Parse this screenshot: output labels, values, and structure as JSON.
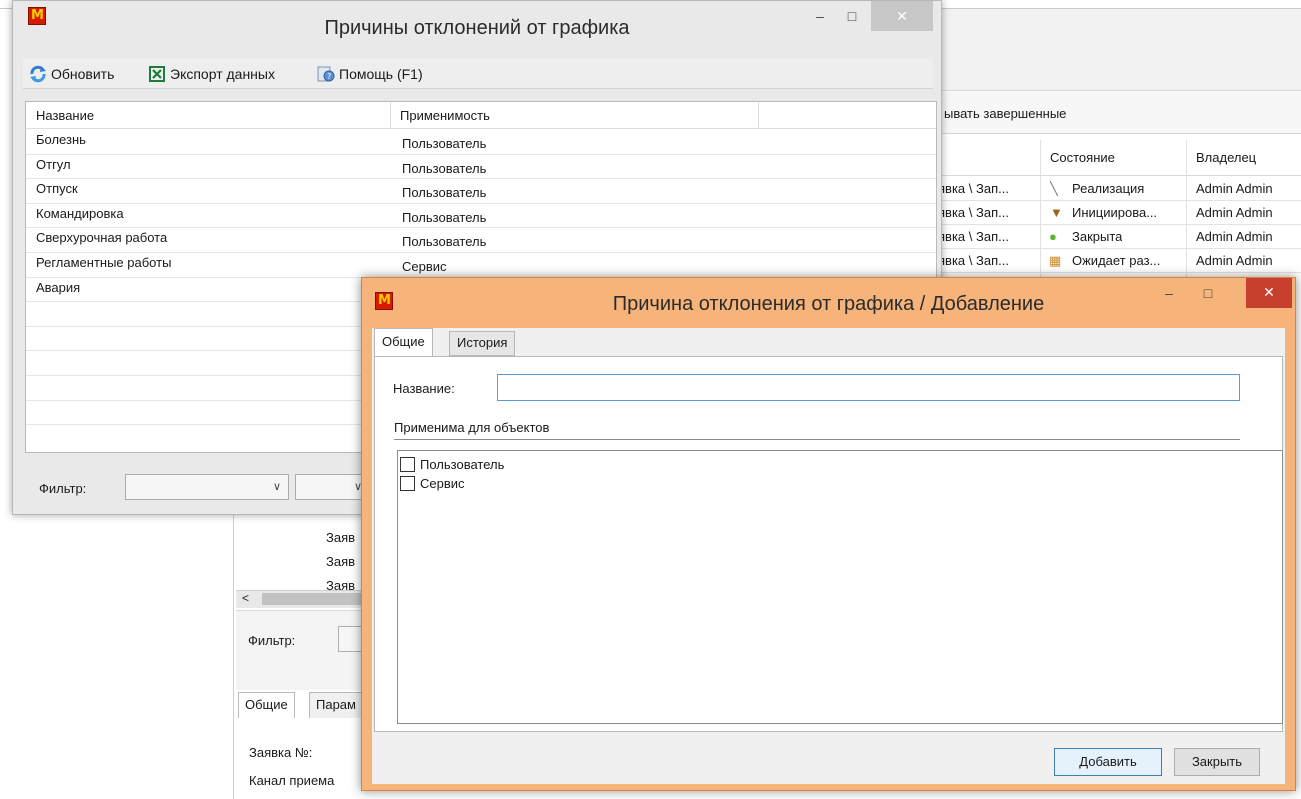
{
  "background_app": {
    "checkbar_text": "ывать завершенные",
    "grid_headers": {
      "state": "Состояние",
      "owner": "Владелец"
    },
    "rows": [
      {
        "type": "явка \\ Зап...",
        "state": "Реализация",
        "owner": "Admin Admin",
        "icon": "wrench-icon"
      },
      {
        "type": "явка \\ Зап...",
        "state": "Инициирова...",
        "owner": "Admin Admin",
        "icon": "cup-icon"
      },
      {
        "type": "явка \\ Зап...",
        "state": "Закрыта",
        "owner": "Admin Admin",
        "icon": "check-circle-icon"
      },
      {
        "type": "явка \\ Зап...",
        "state": "Ожидает раз...",
        "owner": "Admin Admin",
        "icon": "puzzle-icon"
      }
    ],
    "lower_rows": [
      "Заяв",
      "Заяв",
      "Заяв"
    ],
    "filter_label": "Фильтр:",
    "tabs": [
      "Общие",
      "Парам"
    ],
    "fields": {
      "request_no": "Заявка №:",
      "channel": "Канал приема"
    }
  },
  "list_window": {
    "title": "Причины отклонений от графика",
    "toolbar": {
      "refresh": "Обновить",
      "export": "Экспорт данных",
      "help": "Помощь (F1)"
    },
    "columns": [
      "Название",
      "Применимость"
    ],
    "rows": [
      {
        "name": "Болезнь",
        "applicability": "Пользователь"
      },
      {
        "name": "Отгул",
        "applicability": "Пользователь"
      },
      {
        "name": "Отпуск",
        "applicability": "Пользователь"
      },
      {
        "name": "Командировка",
        "applicability": "Пользователь"
      },
      {
        "name": "Сверхурочная работа",
        "applicability": "Пользователь"
      },
      {
        "name": "Регламентные работы",
        "applicability": "Сервис"
      },
      {
        "name": "Авария",
        "applicability": ""
      }
    ],
    "filter_label": "Фильтр:"
  },
  "add_dialog": {
    "title": "Причина отклонения от графика / Добавление",
    "tabs": [
      "Общие",
      "История"
    ],
    "active_tab": "Общие",
    "name_label": "Название:",
    "name_value": "",
    "group_label": "Применима для объектов",
    "objects": [
      {
        "label": "Пользователь",
        "checked": false
      },
      {
        "label": "Сервис",
        "checked": false
      }
    ],
    "add_button": "Добавить",
    "close_button": "Закрыть"
  },
  "colors": {
    "active_frame": "#f6b37a",
    "close_button_active": "#c7402e",
    "logo_red": "#d71a00",
    "focus_border": "#5b9bd5"
  }
}
